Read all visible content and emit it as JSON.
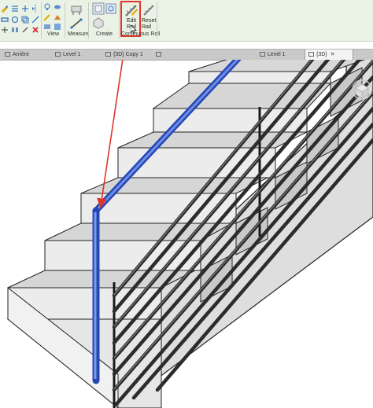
{
  "ribbon": {
    "groups": {
      "view": "View",
      "measure": "Measure",
      "create": "Create",
      "continuous_rail": "Continuous Rail"
    },
    "buttons": {
      "edit_rail": "Edit Rail",
      "reset_rail": "Reset Rail"
    }
  },
  "tabs": [
    {
      "label": "Arrière",
      "closable": false
    },
    {
      "label": "Level 1",
      "closable": false
    },
    {
      "label": "{3D} Copy 1",
      "closable": false
    },
    {
      "label": "",
      "closable": false
    },
    {
      "label": "Level 1",
      "closable": false
    },
    {
      "label": "{3D}",
      "closable": true,
      "active": true
    }
  ],
  "colors": {
    "ribbon_bg": "#e9f2e4",
    "highlight": "#e0352b",
    "selected_rail": "#3355cc",
    "stair_top": "#d6d6d6",
    "stair_riser": "#ececec",
    "stair_side": "#b9b9b9"
  },
  "icons": [
    "edit-rail-icon",
    "reset-rail-icon",
    "measure-icon",
    "create-icon",
    "viewcube-icon"
  ]
}
